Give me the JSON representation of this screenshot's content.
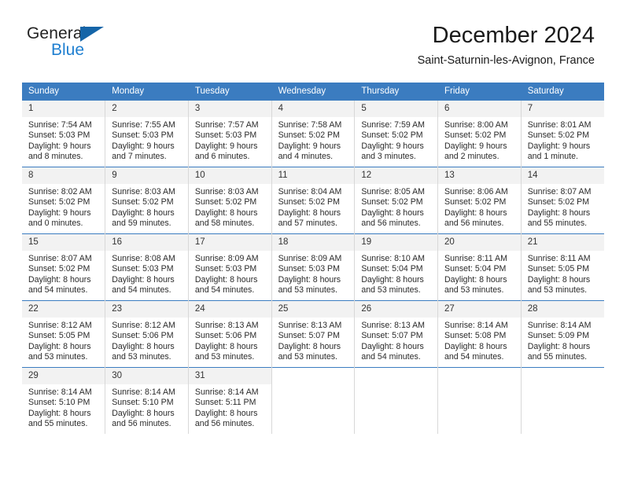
{
  "brand": {
    "name_part1": "General",
    "name_part2": "Blue",
    "triangle_color": "#1565a8",
    "blue_color": "#1f7fd0"
  },
  "header": {
    "title": "December 2024",
    "location": "Saint-Saturnin-les-Avignon, France"
  },
  "theme": {
    "header_bg": "#3b7cc0",
    "header_text": "#ffffff",
    "daynum_bg": "#f2f2f2",
    "cell_border": "#d8d8d8",
    "week_rule": "#3b7cc0"
  },
  "weekday_headers": [
    "Sunday",
    "Monday",
    "Tuesday",
    "Wednesday",
    "Thursday",
    "Friday",
    "Saturday"
  ],
  "weeks": [
    [
      {
        "day": "1",
        "sunrise": "Sunrise: 7:54 AM",
        "sunset": "Sunset: 5:03 PM",
        "daylight1": "Daylight: 9 hours",
        "daylight2": "and 8 minutes."
      },
      {
        "day": "2",
        "sunrise": "Sunrise: 7:55 AM",
        "sunset": "Sunset: 5:03 PM",
        "daylight1": "Daylight: 9 hours",
        "daylight2": "and 7 minutes."
      },
      {
        "day": "3",
        "sunrise": "Sunrise: 7:57 AM",
        "sunset": "Sunset: 5:03 PM",
        "daylight1": "Daylight: 9 hours",
        "daylight2": "and 6 minutes."
      },
      {
        "day": "4",
        "sunrise": "Sunrise: 7:58 AM",
        "sunset": "Sunset: 5:02 PM",
        "daylight1": "Daylight: 9 hours",
        "daylight2": "and 4 minutes."
      },
      {
        "day": "5",
        "sunrise": "Sunrise: 7:59 AM",
        "sunset": "Sunset: 5:02 PM",
        "daylight1": "Daylight: 9 hours",
        "daylight2": "and 3 minutes."
      },
      {
        "day": "6",
        "sunrise": "Sunrise: 8:00 AM",
        "sunset": "Sunset: 5:02 PM",
        "daylight1": "Daylight: 9 hours",
        "daylight2": "and 2 minutes."
      },
      {
        "day": "7",
        "sunrise": "Sunrise: 8:01 AM",
        "sunset": "Sunset: 5:02 PM",
        "daylight1": "Daylight: 9 hours",
        "daylight2": "and 1 minute."
      }
    ],
    [
      {
        "day": "8",
        "sunrise": "Sunrise: 8:02 AM",
        "sunset": "Sunset: 5:02 PM",
        "daylight1": "Daylight: 9 hours",
        "daylight2": "and 0 minutes."
      },
      {
        "day": "9",
        "sunrise": "Sunrise: 8:03 AM",
        "sunset": "Sunset: 5:02 PM",
        "daylight1": "Daylight: 8 hours",
        "daylight2": "and 59 minutes."
      },
      {
        "day": "10",
        "sunrise": "Sunrise: 8:03 AM",
        "sunset": "Sunset: 5:02 PM",
        "daylight1": "Daylight: 8 hours",
        "daylight2": "and 58 minutes."
      },
      {
        "day": "11",
        "sunrise": "Sunrise: 8:04 AM",
        "sunset": "Sunset: 5:02 PM",
        "daylight1": "Daylight: 8 hours",
        "daylight2": "and 57 minutes."
      },
      {
        "day": "12",
        "sunrise": "Sunrise: 8:05 AM",
        "sunset": "Sunset: 5:02 PM",
        "daylight1": "Daylight: 8 hours",
        "daylight2": "and 56 minutes."
      },
      {
        "day": "13",
        "sunrise": "Sunrise: 8:06 AM",
        "sunset": "Sunset: 5:02 PM",
        "daylight1": "Daylight: 8 hours",
        "daylight2": "and 56 minutes."
      },
      {
        "day": "14",
        "sunrise": "Sunrise: 8:07 AM",
        "sunset": "Sunset: 5:02 PM",
        "daylight1": "Daylight: 8 hours",
        "daylight2": "and 55 minutes."
      }
    ],
    [
      {
        "day": "15",
        "sunrise": "Sunrise: 8:07 AM",
        "sunset": "Sunset: 5:02 PM",
        "daylight1": "Daylight: 8 hours",
        "daylight2": "and 54 minutes."
      },
      {
        "day": "16",
        "sunrise": "Sunrise: 8:08 AM",
        "sunset": "Sunset: 5:03 PM",
        "daylight1": "Daylight: 8 hours",
        "daylight2": "and 54 minutes."
      },
      {
        "day": "17",
        "sunrise": "Sunrise: 8:09 AM",
        "sunset": "Sunset: 5:03 PM",
        "daylight1": "Daylight: 8 hours",
        "daylight2": "and 54 minutes."
      },
      {
        "day": "18",
        "sunrise": "Sunrise: 8:09 AM",
        "sunset": "Sunset: 5:03 PM",
        "daylight1": "Daylight: 8 hours",
        "daylight2": "and 53 minutes."
      },
      {
        "day": "19",
        "sunrise": "Sunrise: 8:10 AM",
        "sunset": "Sunset: 5:04 PM",
        "daylight1": "Daylight: 8 hours",
        "daylight2": "and 53 minutes."
      },
      {
        "day": "20",
        "sunrise": "Sunrise: 8:11 AM",
        "sunset": "Sunset: 5:04 PM",
        "daylight1": "Daylight: 8 hours",
        "daylight2": "and 53 minutes."
      },
      {
        "day": "21",
        "sunrise": "Sunrise: 8:11 AM",
        "sunset": "Sunset: 5:05 PM",
        "daylight1": "Daylight: 8 hours",
        "daylight2": "and 53 minutes."
      }
    ],
    [
      {
        "day": "22",
        "sunrise": "Sunrise: 8:12 AM",
        "sunset": "Sunset: 5:05 PM",
        "daylight1": "Daylight: 8 hours",
        "daylight2": "and 53 minutes."
      },
      {
        "day": "23",
        "sunrise": "Sunrise: 8:12 AM",
        "sunset": "Sunset: 5:06 PM",
        "daylight1": "Daylight: 8 hours",
        "daylight2": "and 53 minutes."
      },
      {
        "day": "24",
        "sunrise": "Sunrise: 8:13 AM",
        "sunset": "Sunset: 5:06 PM",
        "daylight1": "Daylight: 8 hours",
        "daylight2": "and 53 minutes."
      },
      {
        "day": "25",
        "sunrise": "Sunrise: 8:13 AM",
        "sunset": "Sunset: 5:07 PM",
        "daylight1": "Daylight: 8 hours",
        "daylight2": "and 53 minutes."
      },
      {
        "day": "26",
        "sunrise": "Sunrise: 8:13 AM",
        "sunset": "Sunset: 5:07 PM",
        "daylight1": "Daylight: 8 hours",
        "daylight2": "and 54 minutes."
      },
      {
        "day": "27",
        "sunrise": "Sunrise: 8:14 AM",
        "sunset": "Sunset: 5:08 PM",
        "daylight1": "Daylight: 8 hours",
        "daylight2": "and 54 minutes."
      },
      {
        "day": "28",
        "sunrise": "Sunrise: 8:14 AM",
        "sunset": "Sunset: 5:09 PM",
        "daylight1": "Daylight: 8 hours",
        "daylight2": "and 55 minutes."
      }
    ],
    [
      {
        "day": "29",
        "sunrise": "Sunrise: 8:14 AM",
        "sunset": "Sunset: 5:10 PM",
        "daylight1": "Daylight: 8 hours",
        "daylight2": "and 55 minutes."
      },
      {
        "day": "30",
        "sunrise": "Sunrise: 8:14 AM",
        "sunset": "Sunset: 5:10 PM",
        "daylight1": "Daylight: 8 hours",
        "daylight2": "and 56 minutes."
      },
      {
        "day": "31",
        "sunrise": "Sunrise: 8:14 AM",
        "sunset": "Sunset: 5:11 PM",
        "daylight1": "Daylight: 8 hours",
        "daylight2": "and 56 minutes."
      },
      {
        "day": "",
        "sunrise": "",
        "sunset": "",
        "daylight1": "",
        "daylight2": ""
      },
      {
        "day": "",
        "sunrise": "",
        "sunset": "",
        "daylight1": "",
        "daylight2": ""
      },
      {
        "day": "",
        "sunrise": "",
        "sunset": "",
        "daylight1": "",
        "daylight2": ""
      },
      {
        "day": "",
        "sunrise": "",
        "sunset": "",
        "daylight1": "",
        "daylight2": ""
      }
    ]
  ]
}
